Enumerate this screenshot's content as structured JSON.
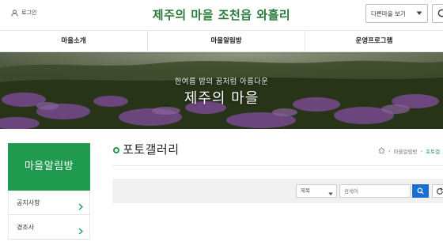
{
  "header": {
    "login_label": "로그인",
    "site_title": "제주의 마을 조천읍 와흘리",
    "village_select_value": "다른마을 보기"
  },
  "nav": {
    "items": [
      {
        "label": "마을소개"
      },
      {
        "label": "마을알림방"
      },
      {
        "label": "운영프로그램"
      }
    ]
  },
  "hero": {
    "subtitle": "한여름 밤의 꿈처럼 아름다운",
    "title": "제주의 마을"
  },
  "sidebar": {
    "heading": "마을알림방",
    "items": [
      {
        "label": "공지사항"
      },
      {
        "label": "경조사"
      }
    ]
  },
  "content": {
    "page_title": "포토갤러리",
    "breadcrumb": {
      "section": "마을알림방",
      "current": "포토갤"
    },
    "search": {
      "field_value": "제목",
      "keyword_placeholder": "검색어"
    }
  },
  "colors": {
    "brand_green": "#1f9a4f",
    "title_green": "#2a7a3b",
    "search_blue": "#1a6fd1"
  }
}
